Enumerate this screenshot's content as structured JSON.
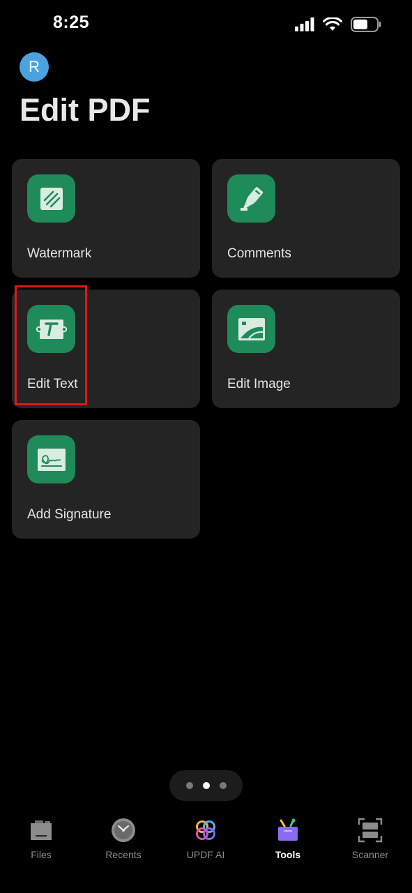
{
  "status_bar": {
    "time": "8:25"
  },
  "header": {
    "avatar_letter": "R",
    "title": "Edit PDF"
  },
  "tools": [
    {
      "label": "Watermark",
      "icon": "watermark-icon"
    },
    {
      "label": "Comments",
      "icon": "highlighter-icon"
    },
    {
      "label": "Edit Text",
      "icon": "edit-text-icon"
    },
    {
      "label": "Edit Image",
      "icon": "image-icon"
    },
    {
      "label": "Add Signature",
      "icon": "signature-icon"
    }
  ],
  "pager": {
    "pages": 3,
    "current": 2
  },
  "tab_bar": {
    "tabs": [
      {
        "label": "Files",
        "icon": "folder-icon"
      },
      {
        "label": "Recents",
        "icon": "clock-icon"
      },
      {
        "label": "UPDF AI",
        "icon": "ai-icon"
      },
      {
        "label": "Tools",
        "icon": "toolbox-icon",
        "active": true
      },
      {
        "label": "Scanner",
        "icon": "scanner-icon"
      }
    ]
  },
  "colors": {
    "accent_green": "#1f8a5a",
    "card_bg": "#242424",
    "highlight_red": "#e0161c",
    "tools_purple": "#8b6cf0"
  }
}
